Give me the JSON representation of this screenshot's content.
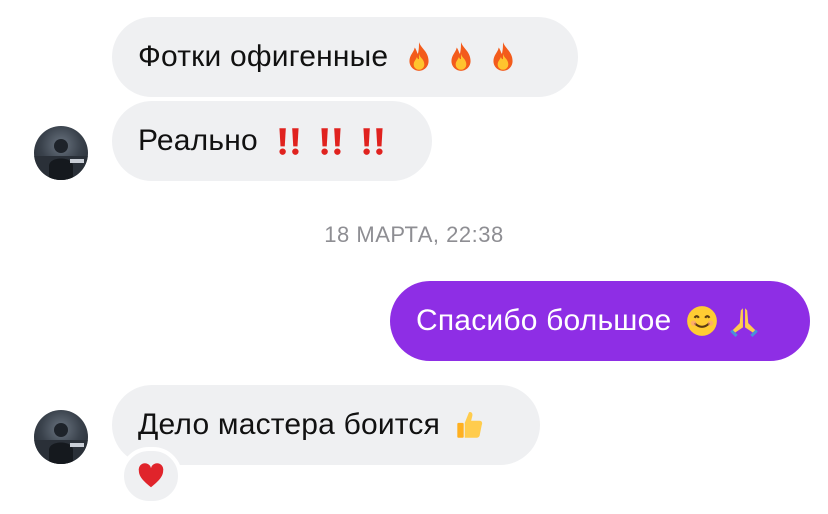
{
  "messages": [
    {
      "direction": "incoming",
      "text": "Фотки офигенные",
      "emoji": [
        "fire-icon",
        "fire-icon",
        "fire-icon"
      ]
    },
    {
      "direction": "incoming",
      "text": "Реально",
      "emoji": [
        "double-exclamation-icon",
        "double-exclamation-icon",
        "double-exclamation-icon"
      ]
    },
    {
      "direction": "outgoing",
      "text": "Спасибо большое",
      "emoji": [
        "smiling-face-icon",
        "folded-hands-icon"
      ]
    },
    {
      "direction": "incoming",
      "text": "Дело мастера боится",
      "emoji": [
        "thumbs-up-icon"
      ],
      "reaction": "heart-icon"
    }
  ],
  "timestamp": "18 МАРТА, 22:38",
  "colors": {
    "incoming_bubble": "#eff0f2",
    "outgoing_bubble": "#8e2ee5",
    "outgoing_text": "#ffffff",
    "timestamp_text": "#8e8e93",
    "exclamation": "#e0221f",
    "heart": "#e0242b"
  }
}
